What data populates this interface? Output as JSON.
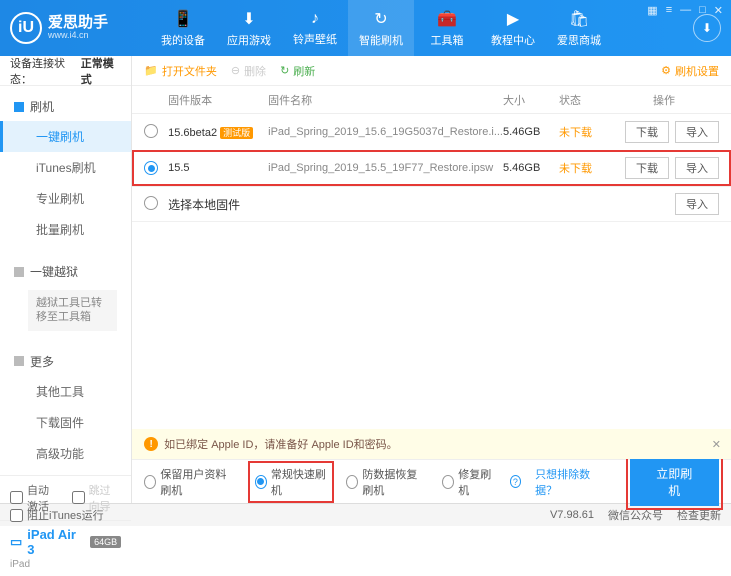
{
  "app": {
    "name": "爱思助手",
    "url": "www.i4.cn",
    "logo_letter": "iU"
  },
  "win_controls": [
    "▦",
    "≡",
    "—",
    "□",
    "✕"
  ],
  "nav": [
    {
      "icon": "📱",
      "label": "我的设备"
    },
    {
      "icon": "⬇",
      "label": "应用游戏"
    },
    {
      "icon": "♪",
      "label": "铃声壁纸"
    },
    {
      "icon": "↻",
      "label": "智能刷机",
      "active": true
    },
    {
      "icon": "🧰",
      "label": "工具箱"
    },
    {
      "icon": "▶",
      "label": "教程中心"
    },
    {
      "icon": "🛍",
      "label": "爱思商城"
    }
  ],
  "status": {
    "label": "设备连接状态：",
    "value": "正常模式"
  },
  "sidebar": {
    "flash": {
      "title": "刷机",
      "items": [
        "一键刷机",
        "iTunes刷机",
        "专业刷机",
        "批量刷机"
      ],
      "active": 0
    },
    "jailbreak": {
      "title": "一键越狱",
      "note": "越狱工具已转移至工具箱"
    },
    "more": {
      "title": "更多",
      "items": [
        "其他工具",
        "下载固件",
        "高级功能"
      ]
    },
    "auto_activate": "自动激活",
    "skip_guide": "跳过向导",
    "device": {
      "name": "iPad Air 3",
      "storage": "64GB",
      "type": "iPad"
    }
  },
  "toolbar": {
    "open": "打开文件夹",
    "delete": "删除",
    "refresh": "刷新",
    "settings": "刷机设置"
  },
  "columns": {
    "version": "固件版本",
    "name": "固件名称",
    "size": "大小",
    "state": "状态",
    "ops": "操作"
  },
  "firmware": [
    {
      "version": "15.6beta2",
      "beta": "测试版",
      "name": "iPad_Spring_2019_15.6_19G5037d_Restore.i...",
      "size": "5.46GB",
      "state": "未下载",
      "selected": false
    },
    {
      "version": "15.5",
      "name": "iPad_Spring_2019_15.5_19F77_Restore.ipsw",
      "size": "5.46GB",
      "state": "未下载",
      "selected": true
    }
  ],
  "local_fw": "选择本地固件",
  "buttons": {
    "download": "下载",
    "import": "导入"
  },
  "warning": "如已绑定 Apple ID，请准备好 Apple ID和密码。",
  "options": {
    "keep": "保留用户资料刷机",
    "normal": "常规快速刷机",
    "recovery": "防数据恢复刷机",
    "repair": "修复刷机",
    "exclude": "只想排除数据？",
    "start": "立即刷机"
  },
  "footer": {
    "block": "阻止iTunes运行",
    "version": "V7.98.61",
    "wechat": "微信公众号",
    "update": "检查更新"
  }
}
